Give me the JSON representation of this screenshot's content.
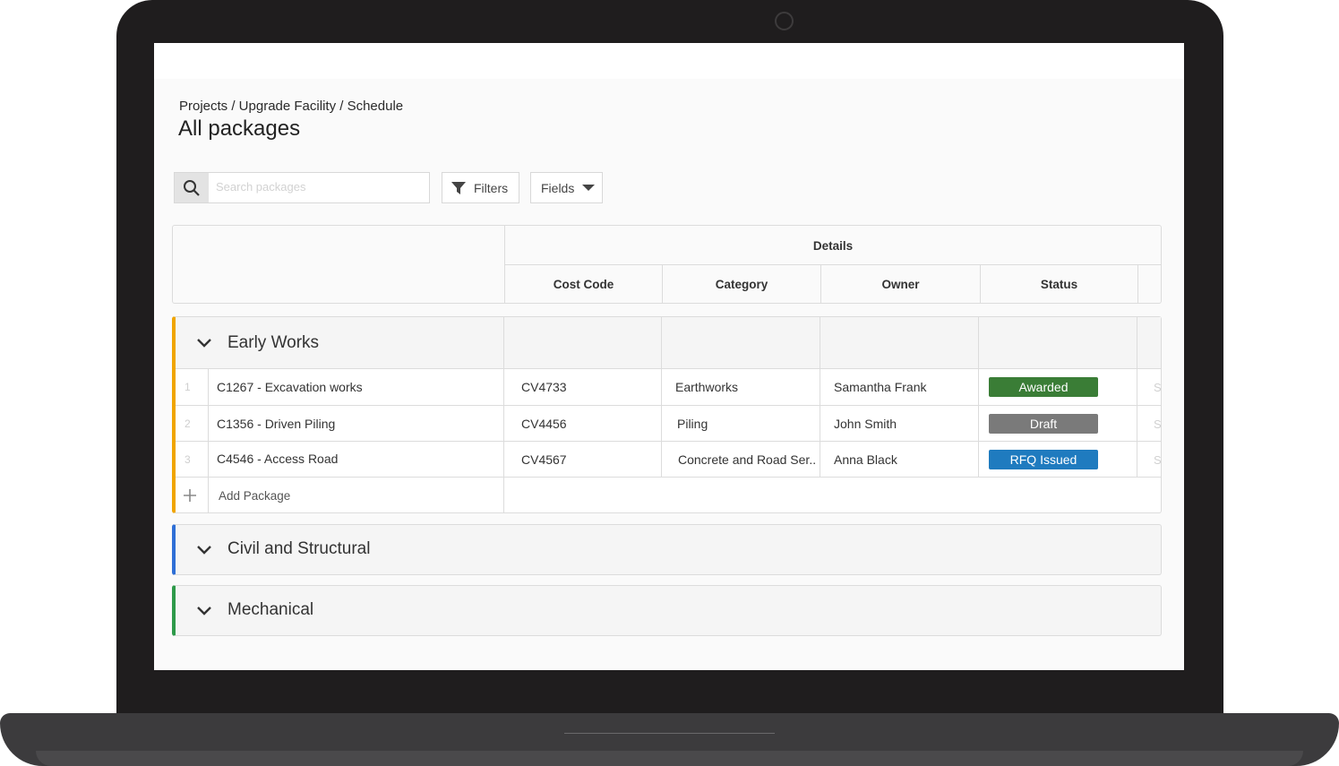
{
  "breadcrumb": "Projects / Upgrade Facility / Schedule",
  "page_title": "All packages",
  "search": {
    "placeholder": "Search packages",
    "icon": "search-icon"
  },
  "toolbar": {
    "filters_label": "Filters",
    "fields_label": "Fields"
  },
  "table": {
    "group_header": "Details",
    "columns": [
      "Cost Code",
      "Category",
      "Owner",
      "Status"
    ],
    "truncated_column_letter": "S"
  },
  "groups": [
    {
      "name": "Early Works",
      "color": "#f0a500",
      "expanded": true,
      "rows": [
        {
          "num": "1",
          "package": "C1267 -  Excavation works",
          "cost_code": "CV4733",
          "category": "Earthworks",
          "owner": "Samantha Frank",
          "status": "Awarded",
          "status_color": "#3a7d36"
        },
        {
          "num": "2",
          "package": "C1356 - Driven Piling",
          "cost_code": "CV4456",
          "category": "Piling",
          "owner": "John Smith",
          "status": "Draft",
          "status_color": "#7a7a7a"
        },
        {
          "num": "3",
          "package": "C4546 - Access Road",
          "cost_code": "CV4567",
          "category": "Concrete and Road Ser..",
          "owner": "Anna Black",
          "status": "RFQ Issued",
          "status_color": "#1f7bbf"
        }
      ],
      "add_label": "Add Package"
    },
    {
      "name": "Civil and Structural",
      "color": "#2f6fd6",
      "expanded": false
    },
    {
      "name": "Mechanical",
      "color": "#2e9a4a",
      "expanded": false
    }
  ]
}
